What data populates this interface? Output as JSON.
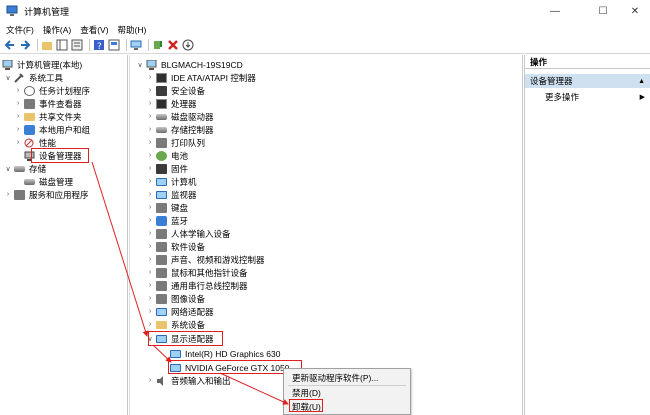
{
  "window": {
    "title": "计算机管理",
    "minimize": "—",
    "maximize": "☐",
    "close": "✕"
  },
  "menu": [
    "文件(F)",
    "操作(A)",
    "查看(V)",
    "帮助(H)"
  ],
  "left_tree": {
    "root": "计算机管理(本地)",
    "system_tools": "系统工具",
    "items": [
      "任务计划程序",
      "事件查看器",
      "共享文件夹",
      "本地用户和组",
      "性能",
      "设备管理器"
    ],
    "storage": "存储",
    "disk_mgmt": "磁盘管理",
    "services": "服务和应用程序"
  },
  "device_tree": {
    "computer": "BLGMACH-19S19CD",
    "categories": [
      "IDE ATA/ATAPI 控制器",
      "安全设备",
      "处理器",
      "磁盘驱动器",
      "存储控制器",
      "打印队列",
      "电池",
      "固件",
      "计算机",
      "监视器",
      "键盘",
      "蓝牙",
      "人体学输入设备",
      "软件设备",
      "声音、视频和游戏控制器",
      "鼠标和其他指针设备",
      "通用串行总线控制器",
      "图像设备",
      "网络适配器",
      "系统设备"
    ],
    "display_adapters": "显示适配器",
    "gpus": [
      "Intel(R) HD Graphics 630",
      "NVIDIA GeForce GTX 1050"
    ],
    "audio": "音频输入和输出"
  },
  "actions": {
    "header": "操作",
    "selected": "设备管理器",
    "more": "更多操作"
  },
  "context_menu": [
    "更新驱动程序软件(P)...",
    "禁用(D)",
    "卸载(U)"
  ],
  "colors": {
    "highlight": "#e02020",
    "selection": "#cfe0f0"
  }
}
